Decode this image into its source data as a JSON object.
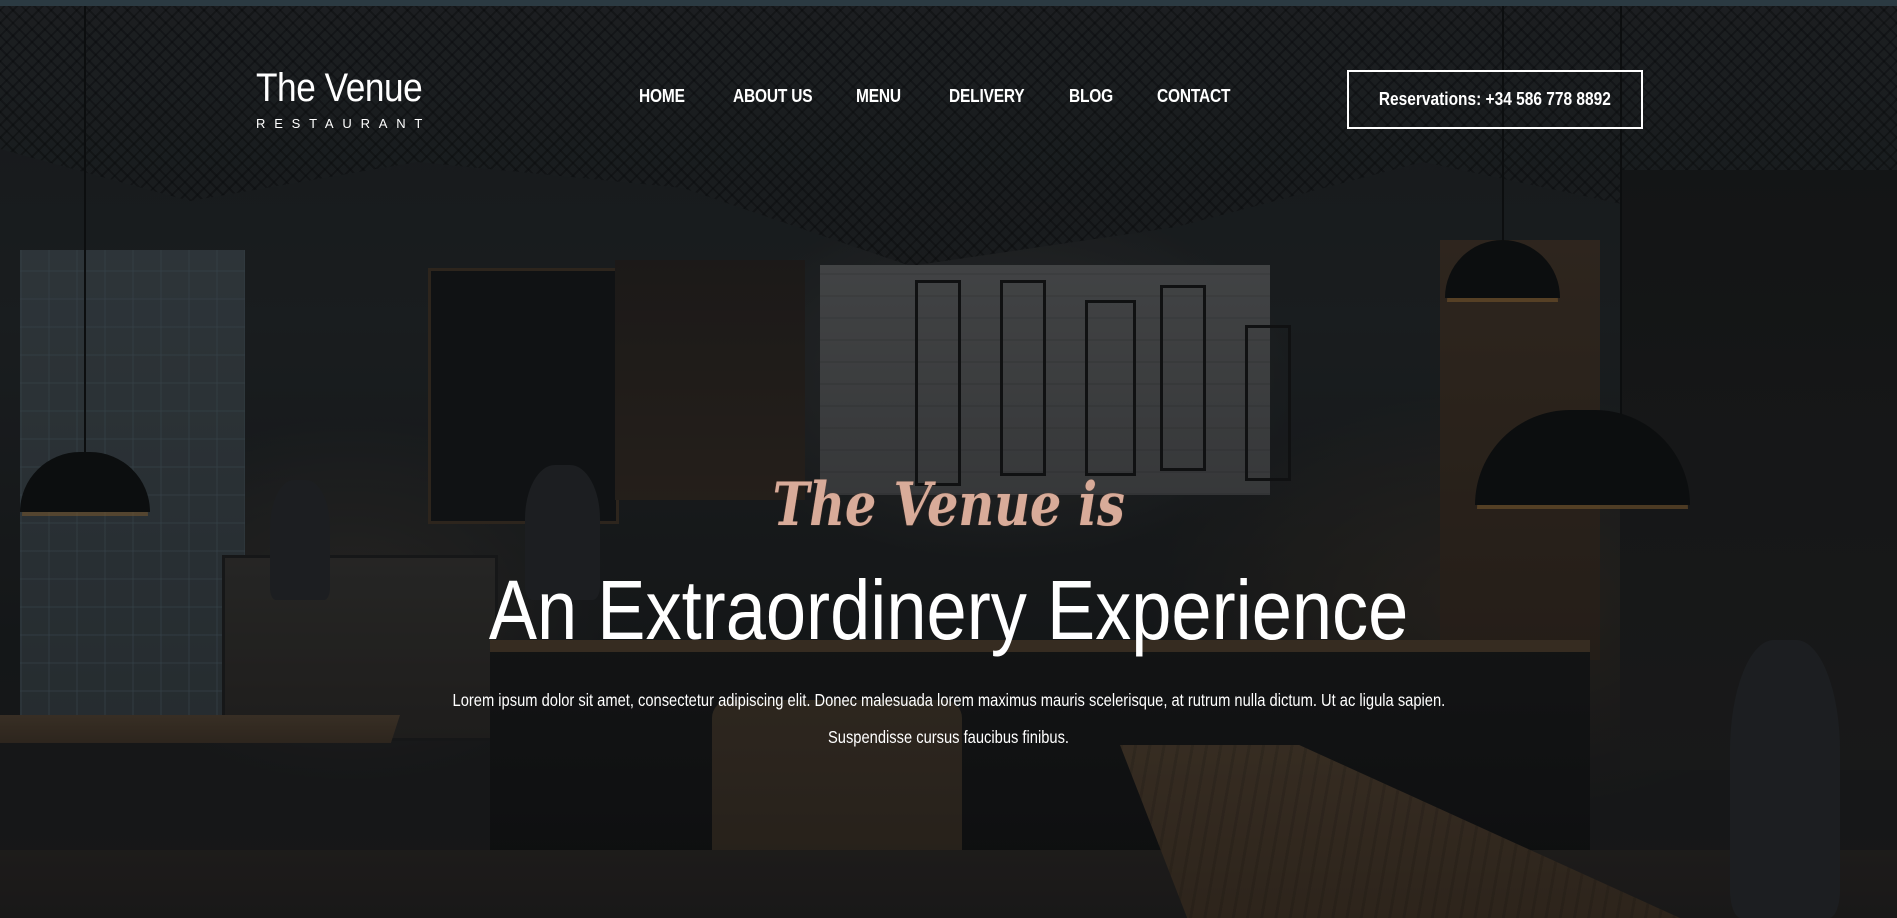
{
  "brand": {
    "name": "The Venue",
    "tagline": "RESTAURANT"
  },
  "nav": {
    "items": [
      {
        "label": "HOME"
      },
      {
        "label": "ABOUT US"
      },
      {
        "label": "MENU"
      },
      {
        "label": "DELIVERY"
      },
      {
        "label": "BLOG"
      },
      {
        "label": "CONTACT"
      }
    ]
  },
  "reservation": {
    "label": "Reservations: +34 586 778 8892"
  },
  "hero": {
    "script_text": "The Venue is",
    "title": "An Extraordinery Experience",
    "description_line1": "Lorem ipsum dolor sit amet, consectetur adipiscing elit. Donec malesuada lorem maximus mauris scelerisque, at rutrum nulla dictum. Ut ac ligula sapien.",
    "description_line2": "Suspendisse cursus faucibus finibus."
  },
  "colors": {
    "script_accent": "#d8ab99",
    "text": "#ffffff",
    "overlay": "#0c0e10"
  }
}
